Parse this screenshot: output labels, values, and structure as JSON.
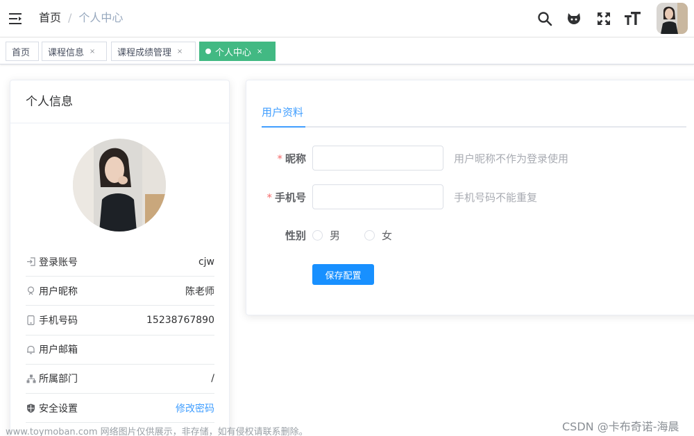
{
  "navbar": {
    "breadcrumb": {
      "home": "首页",
      "separator": "/",
      "current": "个人中心"
    },
    "icons": [
      "menu-fold-icon",
      "search-icon",
      "github-icon",
      "fullscreen-icon",
      "font-size-icon"
    ]
  },
  "tags": [
    {
      "label": "首页",
      "closable": false,
      "active": false
    },
    {
      "label": "课程信息",
      "closable": true,
      "active": false
    },
    {
      "label": "课程成绩管理",
      "closable": true,
      "active": false
    },
    {
      "label": "个人中心",
      "closable": true,
      "active": true
    }
  ],
  "tag_close": "×",
  "profile": {
    "title": "个人信息",
    "rows": [
      {
        "icon": "login-icon",
        "label": "登录账号",
        "value": "cjw"
      },
      {
        "icon": "user-icon",
        "label": "用户昵称",
        "value": "陈老师"
      },
      {
        "icon": "phone-icon",
        "label": "手机号码",
        "value": "15238767890"
      },
      {
        "icon": "email-icon",
        "label": "用户邮箱",
        "value": ""
      },
      {
        "icon": "tree-icon",
        "label": "所属部门",
        "value": "/"
      },
      {
        "icon": "shield-icon",
        "label": "安全设置",
        "value": "修改密码"
      }
    ]
  },
  "form": {
    "tab": "用户资料",
    "required_mark": "*",
    "nickname": {
      "label": "昵称",
      "value": "",
      "hint": "用户昵称不作为登录使用"
    },
    "phone": {
      "label": "手机号",
      "value": "",
      "hint": "手机号码不能重复"
    },
    "gender": {
      "label": "性别",
      "options": [
        "男",
        "女"
      ]
    },
    "save_label": "保存配置"
  },
  "watermark": {
    "left": "www.toymoban.com 网络图片仅供展示，非存储，如有侵权请联系删除。",
    "right": "CSDN @卡布奇诺-海晨"
  },
  "colors": {
    "accent": "#409eff",
    "active_tag": "#42b983",
    "required": "#f56c6c",
    "button": "#1890ff"
  }
}
